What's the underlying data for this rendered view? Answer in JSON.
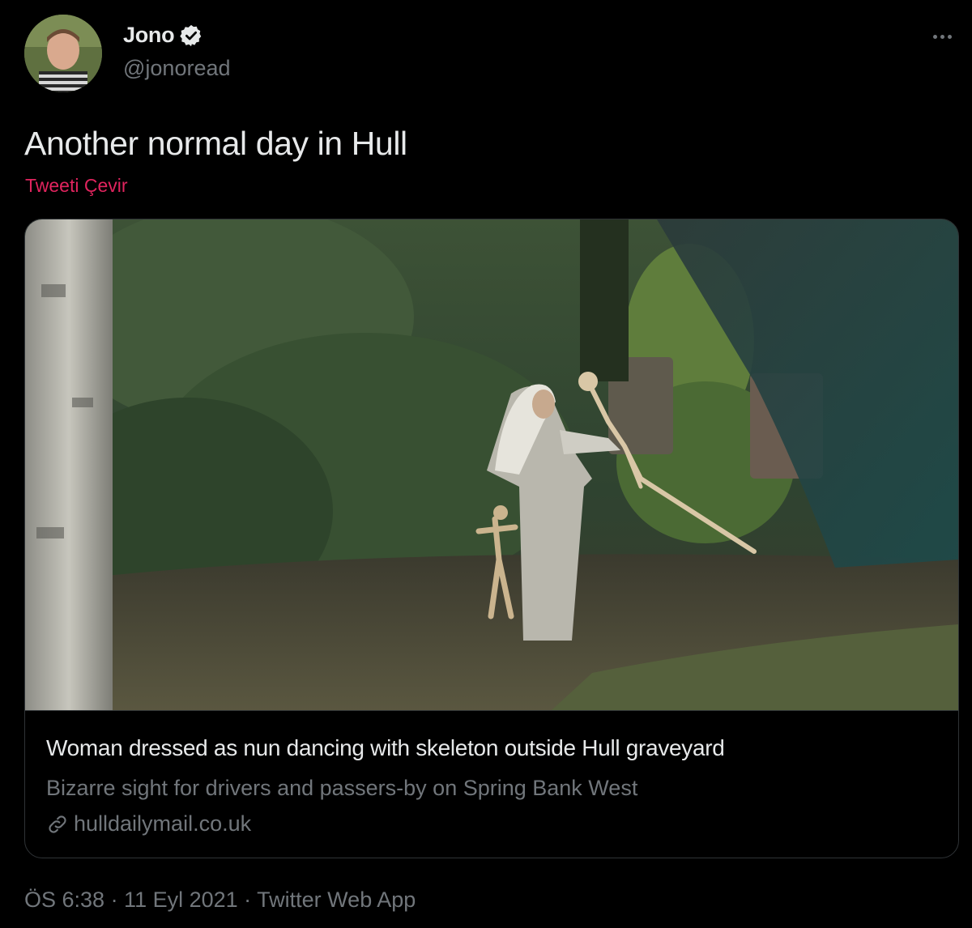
{
  "tweet": {
    "author": {
      "name": "Jono",
      "handle": "@jonoread",
      "verified_icon": "verified-badge-icon"
    },
    "text": "Another normal day in Hull",
    "translate_label": "Tweeti Çevir",
    "more_icon": "more-options-icon",
    "card": {
      "title": "Woman dressed as nun dancing with skeleton outside Hull graveyard",
      "description": "Bizarre sight for drivers and passers-by on Spring Bank West",
      "domain": "hulldailymail.co.uk",
      "link_icon": "link-icon"
    },
    "meta": "ÖS 6:38 · 11 Eyl 2021 · Twitter Web App"
  },
  "colors": {
    "background": "#000000",
    "primary_text": "#e7e9ea",
    "secondary_text": "#71767b",
    "translate_link": "#e0245e",
    "border": "#2f3336"
  }
}
